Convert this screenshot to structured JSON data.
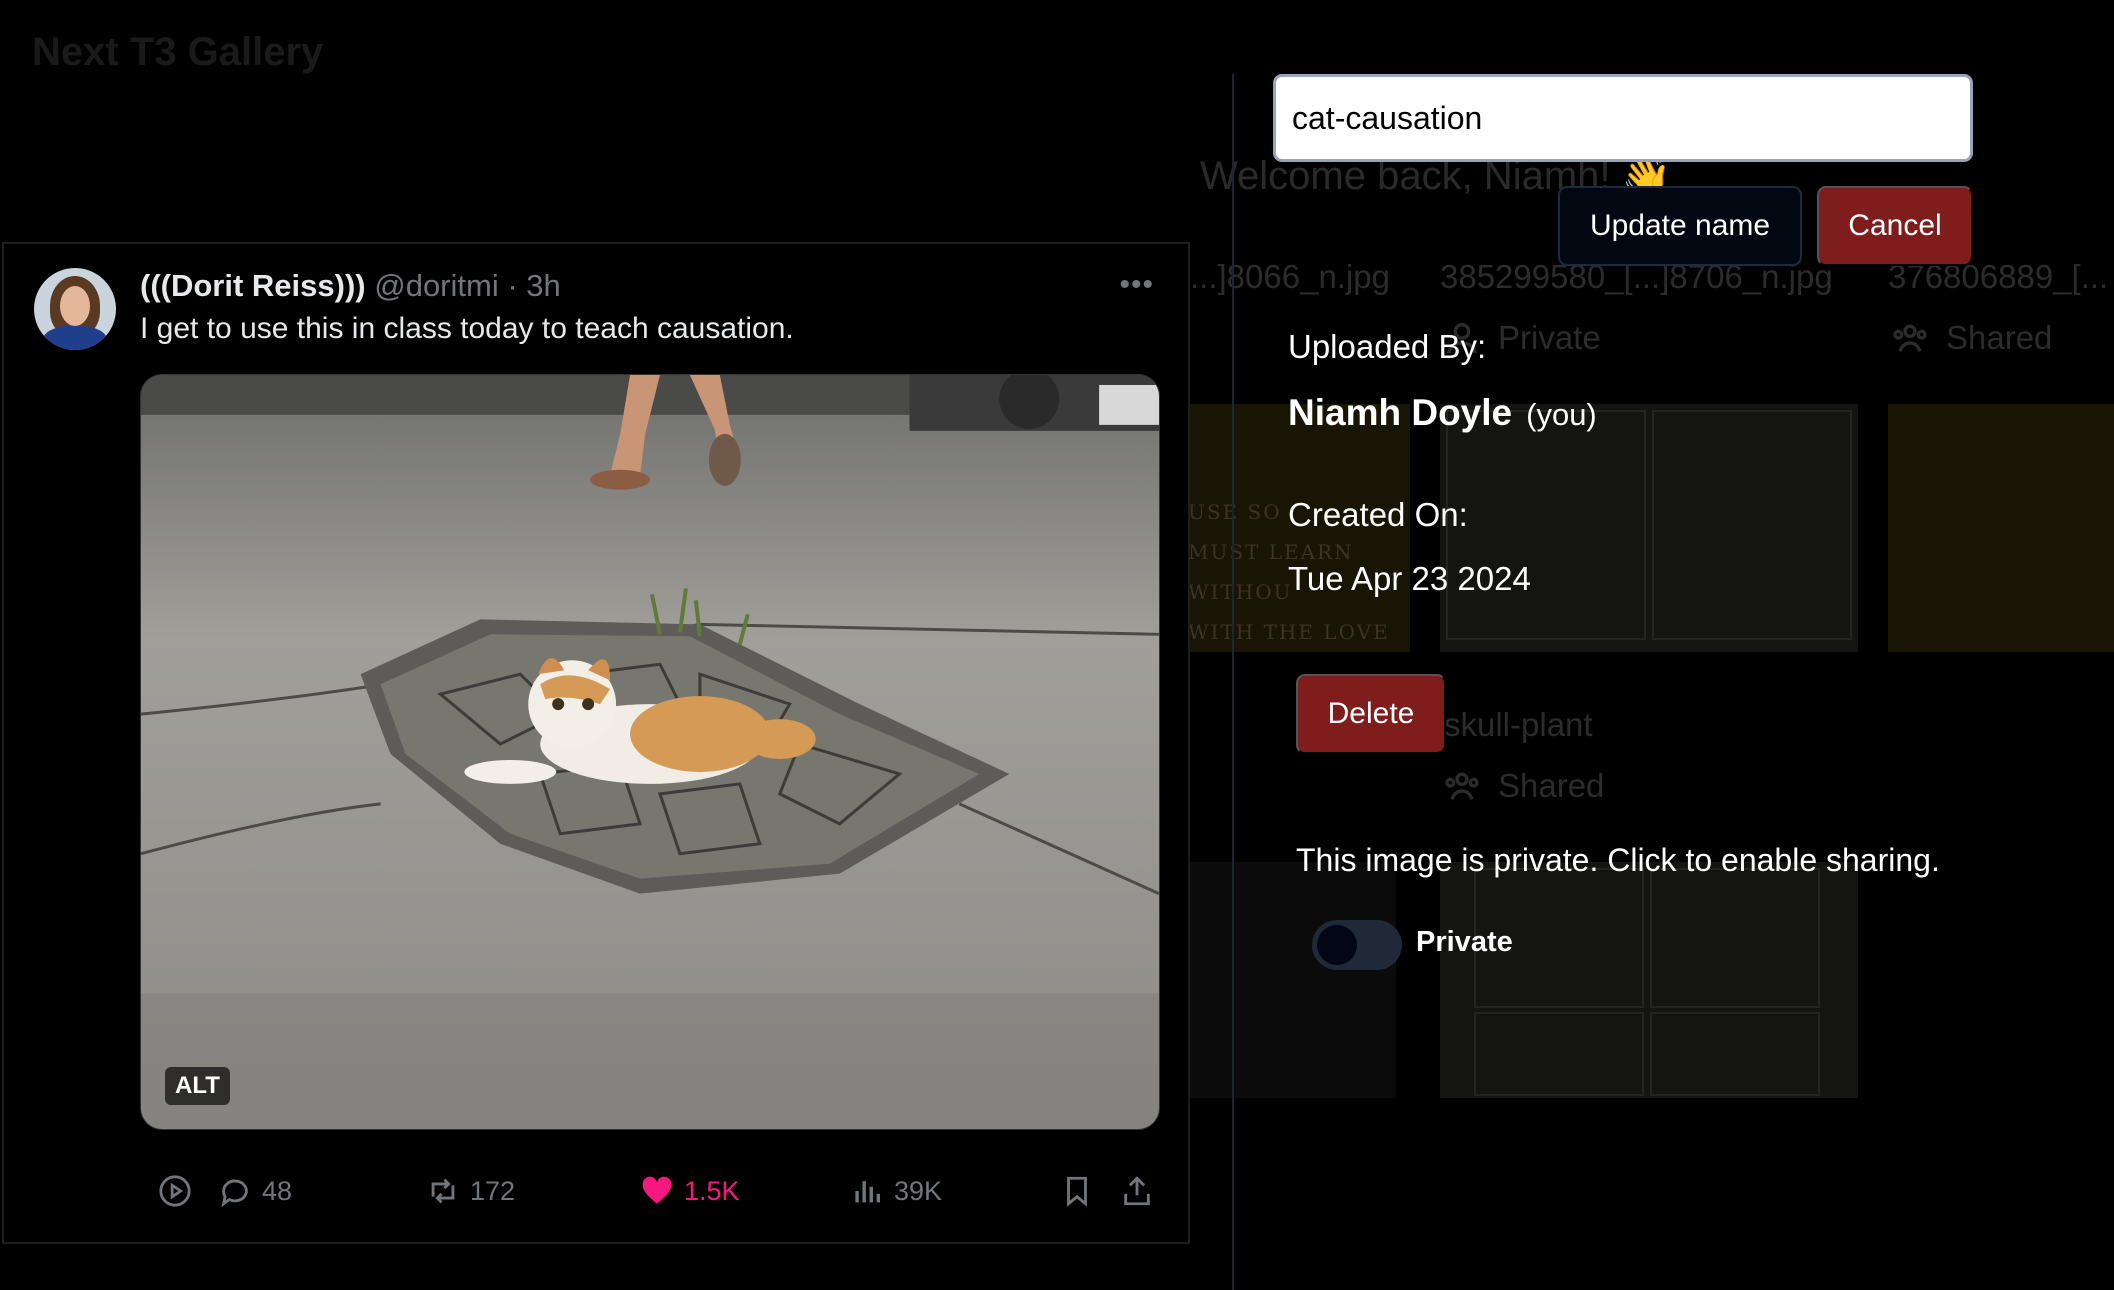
{
  "background": {
    "app_title": "Next T3 Gallery",
    "welcome": "Welcome back, Niamh! 👋",
    "filenames": [
      "...]8066_n.jpg",
      "385299580_[...]8706_n.jpg",
      "376806889_[..."
    ],
    "visibility": [
      "Private",
      "Shared"
    ],
    "second_row_name": "skull-plant",
    "second_row_visibility": "Shared",
    "thumb_texts": [
      "USE SO",
      "MUST LEARN",
      "WITHOU",
      "WITH THE LOVE"
    ]
  },
  "tweet": {
    "author_name": "(((Dorit Reiss)))",
    "author_handle": "@doritmi · 3h",
    "more_icon": "•••",
    "text": "I get to use this in class today to teach causation.",
    "alt_badge": "ALT",
    "replies": "48",
    "retweets": "172",
    "likes": "1.5K",
    "views": "39K",
    "icons": [
      "play-icon",
      "reply-icon",
      "retweet-icon",
      "heart-icon",
      "views-icon",
      "bookmark-icon",
      "share-icon"
    ]
  },
  "modal": {
    "name_value": "cat-causation",
    "update_label": "Update name",
    "cancel_label": "Cancel",
    "uploaded_by_label": "Uploaded By:",
    "uploader_name": "Niamh Doyle",
    "uploader_suffix": "(you)",
    "created_on_label": "Created On:",
    "created_on_value": "Tue Apr 23 2024",
    "delete_label": "Delete",
    "sharing_message": "This image is private. Click to enable sharing.",
    "toggle_label": "Private",
    "toggle_on": false
  },
  "colors": {
    "danger": "#7f1d1d",
    "dark_button": "#030712",
    "like_pink": "#f91880",
    "muted_gray": "#71767b"
  }
}
